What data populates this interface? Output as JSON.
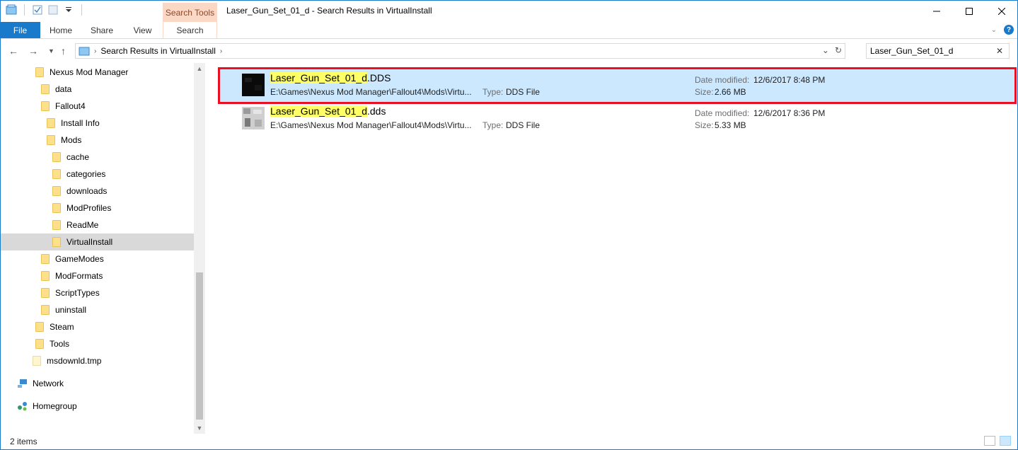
{
  "window": {
    "title": "Laser_Gun_Set_01_d - Search Results in VirtualInstall",
    "contextual_tab_header": "Search Tools",
    "controls": [
      "minimize",
      "maximize",
      "close"
    ]
  },
  "ribbon": {
    "tabs": [
      "File",
      "Home",
      "Share",
      "View",
      "Search"
    ]
  },
  "address": {
    "path": "Search Results in VirtualInstall",
    "search_value": "Laser_Gun_Set_01_d"
  },
  "nav_tree": [
    {
      "label": "Nexus Mod Manager",
      "kind": "folder",
      "level": 0
    },
    {
      "label": "data",
      "kind": "folder",
      "level": 1
    },
    {
      "label": "Fallout4",
      "kind": "folder",
      "level": 1
    },
    {
      "label": "Install Info",
      "kind": "folder",
      "level": 2
    },
    {
      "label": "Mods",
      "kind": "folder",
      "level": 2
    },
    {
      "label": "cache",
      "kind": "folder",
      "level": 3
    },
    {
      "label": "categories",
      "kind": "folder",
      "level": 3
    },
    {
      "label": "downloads",
      "kind": "folder",
      "level": 3
    },
    {
      "label": "ModProfiles",
      "kind": "folder",
      "level": 3
    },
    {
      "label": "ReadMe",
      "kind": "folder",
      "level": 3
    },
    {
      "label": "VirtualInstall",
      "kind": "folder",
      "level": 3,
      "selected": true
    },
    {
      "label": "GameModes",
      "kind": "folder",
      "level": 1
    },
    {
      "label": "ModFormats",
      "kind": "folder",
      "level": 1
    },
    {
      "label": "ScriptTypes",
      "kind": "folder",
      "level": 1
    },
    {
      "label": "uninstall",
      "kind": "folder",
      "level": 1
    },
    {
      "label": "Steam",
      "kind": "folder",
      "level": 0
    },
    {
      "label": "Tools",
      "kind": "folder",
      "level": 0
    },
    {
      "label": "msdownld.tmp",
      "kind": "file",
      "level": -0.5
    }
  ],
  "nav_extra": [
    {
      "label": "Network",
      "icon": "network-icon"
    },
    {
      "label": "Homegroup",
      "icon": "homegroup-icon"
    }
  ],
  "results": [
    {
      "name_highlight": "Laser_Gun_Set_01_d",
      "name_rest": ".DDS",
      "path": "E:\\Games\\Nexus Mod Manager\\Fallout4\\Mods\\Virtu...",
      "type_label": "Type:",
      "type": "DDS File",
      "date_label": "Date modified:",
      "date": "12/6/2017 8:48 PM",
      "size_label": "Size:",
      "size": "2.66 MB",
      "selected": true
    },
    {
      "name_highlight": "Laser_Gun_Set_01_d",
      "name_rest": ".dds",
      "path": "E:\\Games\\Nexus Mod Manager\\Fallout4\\Mods\\Virtu...",
      "type_label": "Type:",
      "type": "DDS File",
      "date_label": "Date modified:",
      "date": "12/6/2017 8:36 PM",
      "size_label": "Size:",
      "size": "5.33 MB",
      "selected": false
    }
  ],
  "status": {
    "item_count": "2 items"
  },
  "colors": {
    "accent": "#1979ca",
    "selection": "#cce8ff",
    "highlight": "#ffff66",
    "annotation": "#e81123"
  }
}
